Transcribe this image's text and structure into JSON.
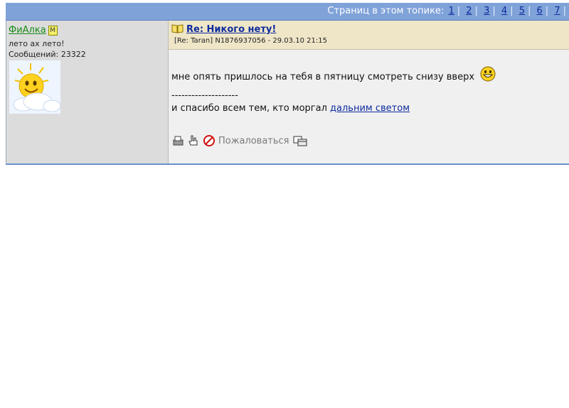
{
  "pages_bar": {
    "label": "Страниц в этом топике:",
    "pages": [
      "1",
      "2",
      "3",
      "4",
      "5",
      "6",
      "7"
    ]
  },
  "author": {
    "name": "ФиАлка",
    "badge": "М",
    "status": "лето ах лето!",
    "messages": "Сообщений: 23322"
  },
  "post": {
    "title": "Re: Никого нету!",
    "meta": "[Re: Taran]  N1876937056 - 29.03.10 21:15",
    "line1": "мне опять пришлось на тебя в пятницу смотреть снизу вверх",
    "separator": "--------------------",
    "line3_prefix": "и спасибо всем тем, кто моргал ",
    "line3_link": "дальним светом",
    "report_label": "Пожаловаться"
  }
}
